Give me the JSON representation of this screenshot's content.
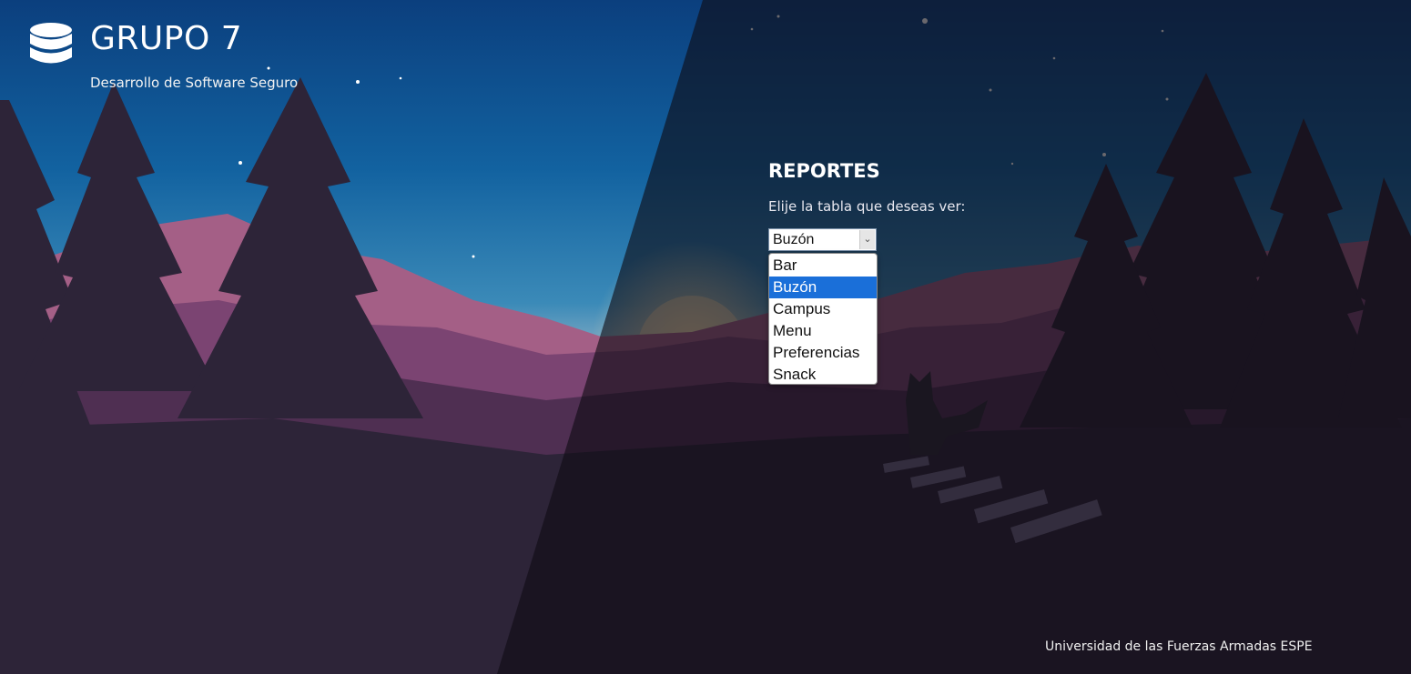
{
  "brand": {
    "icon": "database-icon",
    "title": "GRUPO 7",
    "subtitle": "Desarrollo de Software Seguro"
  },
  "reports": {
    "title": "REPORTES",
    "label": "Elije la tabla que deseas ver:",
    "select": {
      "value": "Buzón",
      "options": [
        "Bar",
        "Buzón",
        "Campus",
        "Menu",
        "Preferencias",
        "Snack"
      ],
      "selected_index": 1
    }
  },
  "footer": {
    "text": "Universidad de las Fuerzas Armadas ESPE"
  },
  "colors": {
    "sky_top": "#0b3f7e",
    "sky_mid": "#1a73b0",
    "mountain_pink": "#a45f86",
    "tree_dark": "#2d2438",
    "overlay_dark": "#15121c",
    "dropdown_highlight": "#1a6fd9"
  }
}
